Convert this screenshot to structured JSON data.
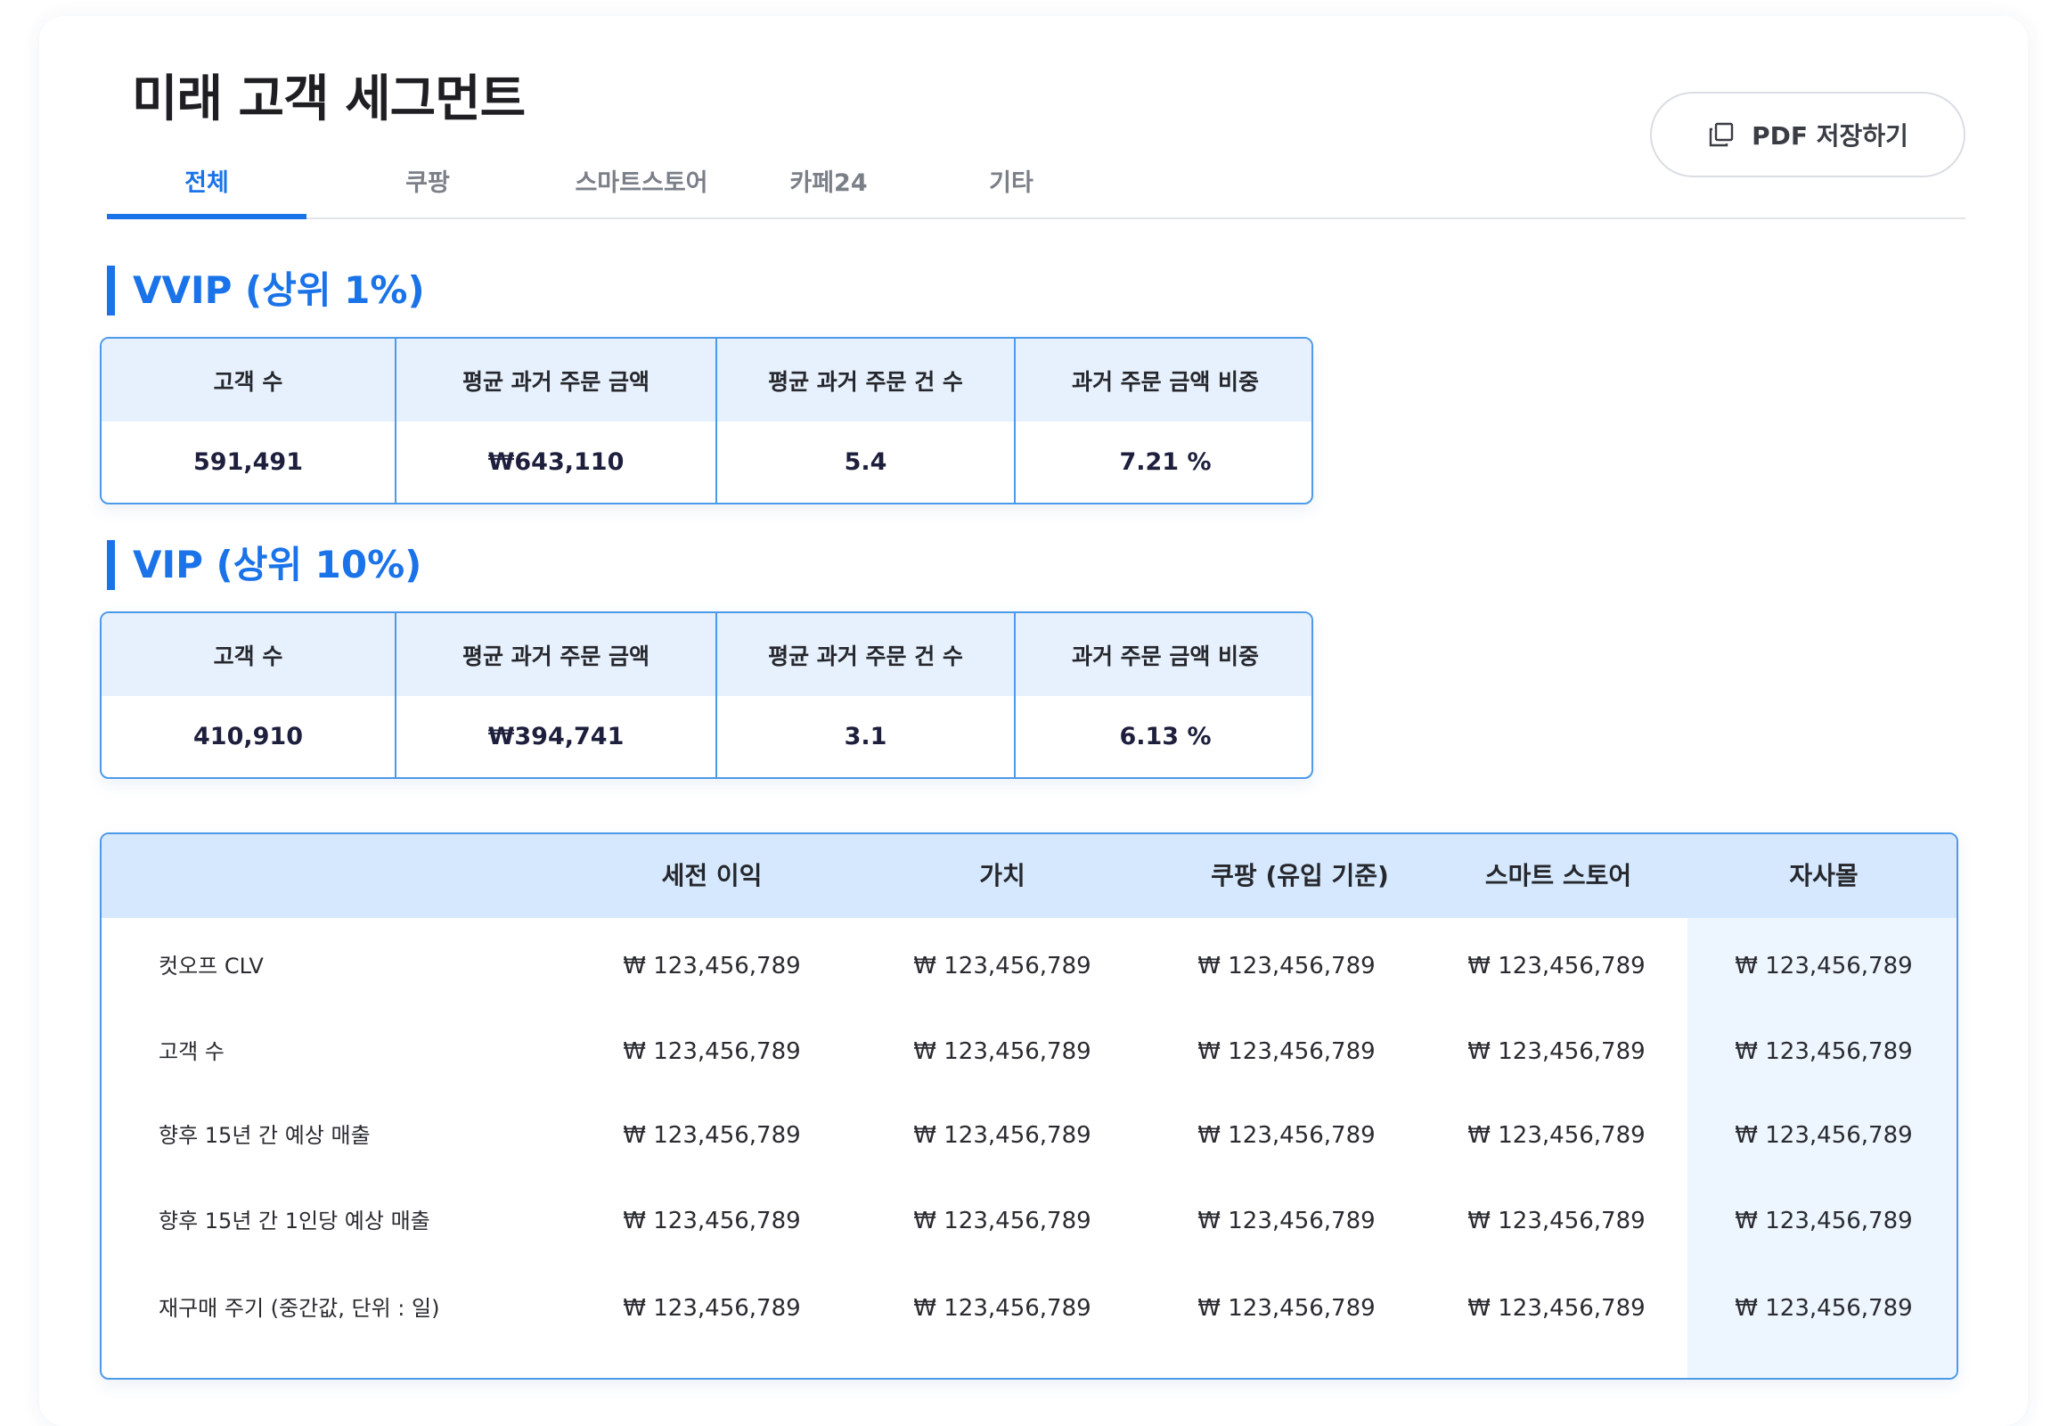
{
  "page": {
    "title": "미래 고객 세그먼트",
    "pdf_button_label": "PDF 저장하기"
  },
  "tabs": [
    {
      "label": "전체",
      "active": true
    },
    {
      "label": "쿠팡",
      "active": false
    },
    {
      "label": "스마트스토어",
      "active": false
    },
    {
      "label": "카페24",
      "active": false
    },
    {
      "label": "기타",
      "active": false
    }
  ],
  "vvip": {
    "title": "VVIP (상위 1%)",
    "headers": [
      "고객 수",
      "평균 과거 주문 금액",
      "평균 과거 주문 건 수",
      "과거 주문 금액 비중"
    ],
    "values": [
      "591,491",
      "₩643,110",
      "5.4",
      "7.21 %"
    ]
  },
  "vip": {
    "title": "VIP (상위 10%)",
    "headers": [
      "고객 수",
      "평균 과거 주문 금액",
      "평균 과거 주문 건 수",
      "과거 주문 금액 비중"
    ],
    "values": [
      "410,910",
      "₩394,741",
      "3.1",
      "6.13 %"
    ]
  },
  "table": {
    "headers": [
      "",
      "세전 이익",
      "가치",
      "쿠팡 (유입 기준)",
      "스마트 스토어",
      "자사몰"
    ],
    "rows": [
      {
        "label": "컷오프 CLV",
        "cells": [
          "₩ 123,456,789",
          "₩ 123,456,789",
          "₩ 123,456,789",
          "₩ 123,456,789",
          "₩ 123,456,789"
        ]
      },
      {
        "label": "고객 수",
        "cells": [
          "₩ 123,456,789",
          "₩ 123,456,789",
          "₩ 123,456,789",
          "₩ 123,456,789",
          "₩ 123,456,789"
        ]
      },
      {
        "label": "향후 15년 간 예상 매출",
        "cells": [
          "₩ 123,456,789",
          "₩ 123,456,789",
          "₩ 123,456,789",
          "₩ 123,456,789",
          "₩ 123,456,789"
        ]
      },
      {
        "label": "향후 15년 간 1인당 예상 매출",
        "cells": [
          "₩ 123,456,789",
          "₩ 123,456,789",
          "₩ 123,456,789",
          "₩ 123,456,789",
          "₩ 123,456,789"
        ]
      },
      {
        "label": "재구매 주기 (중간값, 단위 : 일)",
        "cells": [
          "₩ 123,456,789",
          "₩ 123,456,789",
          "₩ 123,456,789",
          "₩ 123,456,789",
          "₩ 123,456,789"
        ]
      }
    ]
  },
  "icons": {
    "pdf_button": "copy-icon"
  },
  "colors": {
    "accent": "#1a73e8",
    "header_bg": "#d5e8fd",
    "stat_header_bg": "#e6f1fd",
    "highlight_col": "#edf5fe"
  }
}
